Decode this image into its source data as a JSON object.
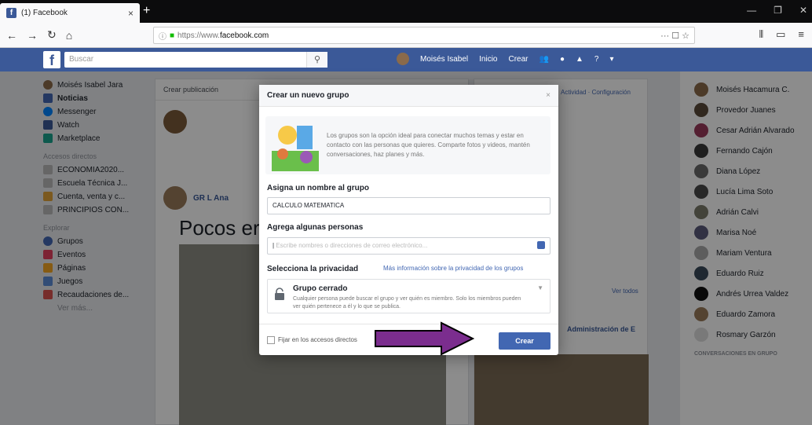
{
  "browser": {
    "tab_title": "(1) Facebook",
    "tab_close": "×",
    "new_tab": "+",
    "url_prefix": "https://www.",
    "url_domain": "facebook.com",
    "url_actions": "··· ☐ ☆",
    "window_controls": [
      "—",
      "❐",
      "✕"
    ]
  },
  "fb": {
    "logo": "f",
    "search_placeholder": "Buscar",
    "nav": [
      "Moisés Isabel",
      "Inicio",
      "Crear"
    ]
  },
  "left": {
    "profile": "Moisés Isabel Jara",
    "items": [
      "Noticias",
      "Messenger",
      "Watch",
      "Marketplace"
    ],
    "accesos_title": "Accesos directos",
    "accesos": [
      "ECONOMIA2020...",
      "Escuela Técnica J...",
      "Cuenta, venta y c...",
      "PRINCIPIOS CON..."
    ],
    "explorar_title": "Explorar",
    "explorar": [
      "Grupos",
      "Eventos",
      "Páginas",
      "Juegos",
      "Recaudaciones de..."
    ],
    "more": "Ver más..."
  },
  "feed": {
    "create_post": "Crear publicación",
    "post_author": "GR L Ana",
    "post_heading": "Pocos er"
  },
  "right": {
    "header": "Actividad · Configuración",
    "see_all": "Ver todos",
    "admin": "Administración de E"
  },
  "chat": {
    "contacts": [
      "Moisés Hacamura C.",
      "Provedor Juanes",
      "Cesar Adrián Alvarado",
      "Fernando Cajón",
      "Diana López",
      "Lucía Lima Soto",
      "Adrián Calvi",
      "Marisa Noé",
      "Mariam Ventura",
      "Eduardo Ruiz",
      "Andrés Urrea Valdez",
      "Eduardo Zamora",
      "Rosmary Garzón"
    ],
    "groups_title": "CONVERSACIONES EN GRUPO"
  },
  "modal": {
    "title": "Crear un nuevo grupo",
    "close": "×",
    "intro": "Los grupos son la opción ideal para conectar muchos temas y estar en contacto con las personas que quieres. Comparte fotos y videos, mantén conversaciones, haz planes y más.",
    "name_label": "Asigna un nombre al grupo",
    "name_value": "CALCULO MATEMATICA",
    "people_label": "Agrega algunas personas",
    "people_placeholder": "Escribe nombres o direcciones de correo electrónico...",
    "privacy_label": "Selecciona la privacidad",
    "privacy_link": "Más información sobre la privacidad de los grupos",
    "privacy_title": "Grupo cerrado",
    "privacy_desc": "Cualquier persona puede buscar el grupo y ver quién es miembro. Solo los miembros pueden ver quién pertenece a él y lo que se publica.",
    "pin_label": "Fijar en los accesos directos",
    "create_button": "Crear"
  },
  "colors": {
    "fb_blue": "#3b5998",
    "button_blue": "#4267b2",
    "arrow_fill": "#7b2d8e"
  }
}
